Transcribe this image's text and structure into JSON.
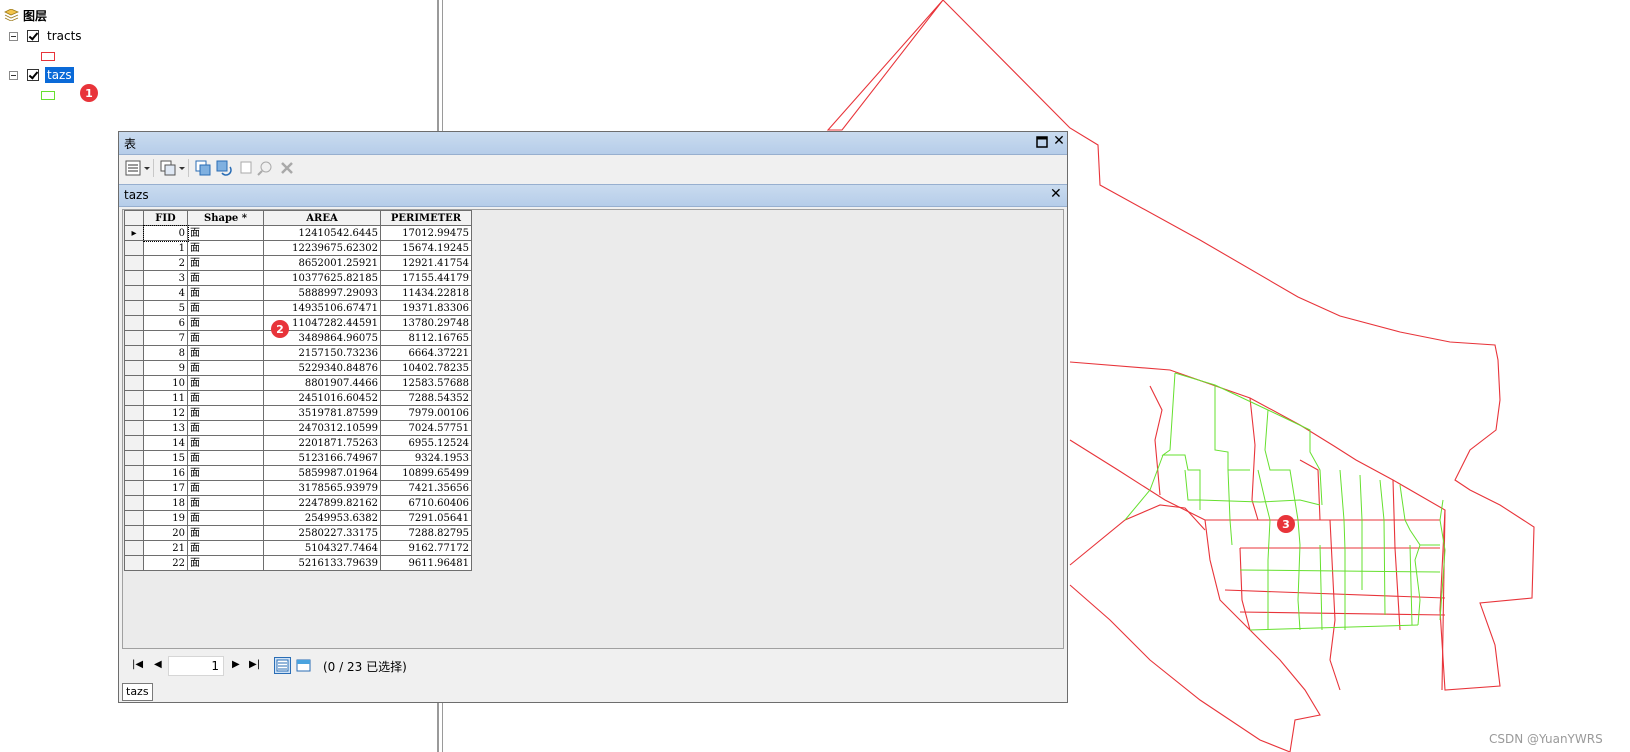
{
  "toc": {
    "root_label": "图层",
    "layers": [
      {
        "label": "tracts",
        "checked": true,
        "selected": false,
        "symbol_color": "#e8343a"
      },
      {
        "label": "tazs",
        "checked": true,
        "selected": true,
        "symbol_color": "#66e02f"
      }
    ]
  },
  "badges": {
    "one": "1",
    "two": "2",
    "three": "3"
  },
  "table_window": {
    "title": "表",
    "tab_name": "tazs",
    "columns": [
      "FID",
      "Shape *",
      "AREA",
      "PERIMETER"
    ],
    "rows": [
      {
        "fid": "0",
        "shape": "面",
        "area": "12410542.6445",
        "perimeter": "17012.99475"
      },
      {
        "fid": "1",
        "shape": "面",
        "area": "12239675.62302",
        "perimeter": "15674.19245"
      },
      {
        "fid": "2",
        "shape": "面",
        "area": "8652001.25921",
        "perimeter": "12921.41754"
      },
      {
        "fid": "3",
        "shape": "面",
        "area": "10377625.82185",
        "perimeter": "17155.44179"
      },
      {
        "fid": "4",
        "shape": "面",
        "area": "5888997.29093",
        "perimeter": "11434.22818"
      },
      {
        "fid": "5",
        "shape": "面",
        "area": "14935106.67471",
        "perimeter": "19371.83306"
      },
      {
        "fid": "6",
        "shape": "面",
        "area": "11047282.44591",
        "perimeter": "13780.29748"
      },
      {
        "fid": "7",
        "shape": "面",
        "area": "3489864.96075",
        "perimeter": "8112.16765"
      },
      {
        "fid": "8",
        "shape": "面",
        "area": "2157150.73236",
        "perimeter": "6664.37221"
      },
      {
        "fid": "9",
        "shape": "面",
        "area": "5229340.84876",
        "perimeter": "10402.78235"
      },
      {
        "fid": "10",
        "shape": "面",
        "area": "8801907.4466",
        "perimeter": "12583.57688"
      },
      {
        "fid": "11",
        "shape": "面",
        "area": "2451016.60452",
        "perimeter": "7288.54352"
      },
      {
        "fid": "12",
        "shape": "面",
        "area": "3519781.87599",
        "perimeter": "7979.00106"
      },
      {
        "fid": "13",
        "shape": "面",
        "area": "2470312.10599",
        "perimeter": "7024.57751"
      },
      {
        "fid": "14",
        "shape": "面",
        "area": "2201871.75263",
        "perimeter": "6955.12524"
      },
      {
        "fid": "15",
        "shape": "面",
        "area": "5123166.74967",
        "perimeter": "9324.1953"
      },
      {
        "fid": "16",
        "shape": "面",
        "area": "5859987.01964",
        "perimeter": "10899.65499"
      },
      {
        "fid": "17",
        "shape": "面",
        "area": "3178565.93979",
        "perimeter": "7421.35656"
      },
      {
        "fid": "18",
        "shape": "面",
        "area": "2247899.82162",
        "perimeter": "6710.60406"
      },
      {
        "fid": "19",
        "shape": "面",
        "area": "2549953.6382",
        "perimeter": "7291.05641"
      },
      {
        "fid": "20",
        "shape": "面",
        "area": "2580227.33175",
        "perimeter": "7288.82795"
      },
      {
        "fid": "21",
        "shape": "面",
        "area": "5104327.7464",
        "perimeter": "9162.77172"
      },
      {
        "fid": "22",
        "shape": "面",
        "area": "5216133.79639",
        "perimeter": "9611.96481"
      }
    ],
    "current_record": "1",
    "selection_status": "(0 / 23 已选择)",
    "bottom_tab": "tazs"
  },
  "watermark": "CSDN @YuanYWRS",
  "colors": {
    "tracts_outline": "#e8343a",
    "tazs_outline": "#66e02f",
    "selection_highlight": "#0a6ad8",
    "badge": "#e8343a"
  }
}
